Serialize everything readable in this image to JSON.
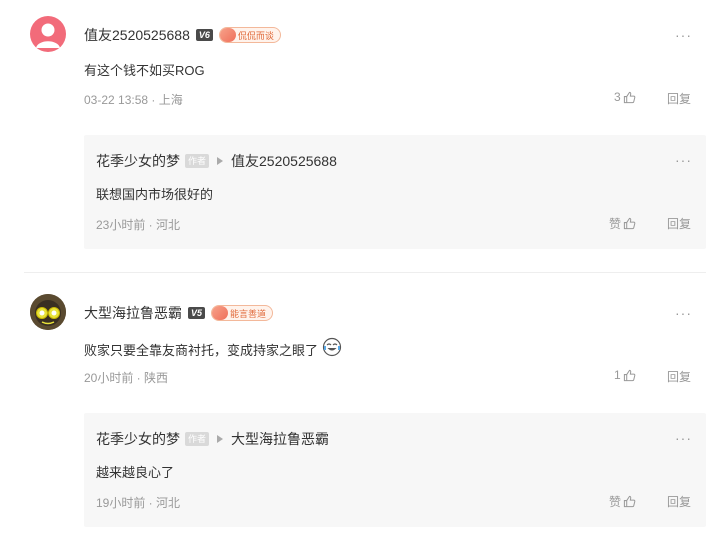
{
  "comments": [
    {
      "username": "值友2520525688",
      "level": "V6",
      "medal": "侃侃而谈",
      "content": "有这个钱不如买ROG",
      "meta": "03-22 13:58 · 上海",
      "likes": "3",
      "reply_label": "回复",
      "more": "···",
      "reply": {
        "username": "花季少女的梦",
        "author_tag": "作者",
        "target": "值友2520525688",
        "content": "联想国内市场很好的",
        "meta": "23小时前 · 河北",
        "like_label": "赞",
        "reply_label": "回复",
        "more": "···"
      }
    },
    {
      "username": "大型海拉鲁恶霸",
      "level": "V5",
      "medal": "能言善道",
      "content": "败家只要全靠友商衬托，变成持家之眼了",
      "meta": "20小时前 · 陕西",
      "likes": "1",
      "reply_label": "回复",
      "more": "···",
      "reply": {
        "username": "花季少女的梦",
        "author_tag": "作者",
        "target": "大型海拉鲁恶霸",
        "content": "越来越良心了",
        "meta": "19小时前 · 河北",
        "like_label": "赞",
        "reply_label": "回复",
        "more": "···"
      }
    }
  ],
  "colors": {
    "avatar_pink": "#f26b7a",
    "medal_orange": "#e06a3a",
    "reply_bg": "#f7f7f7"
  }
}
